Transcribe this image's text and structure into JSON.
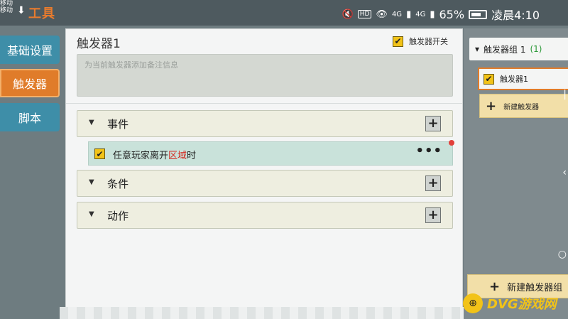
{
  "statusbar": {
    "notif_line1": "移动",
    "notif_line2": "移动",
    "app_title": "工具",
    "hd": "HD",
    "signal1": "4G",
    "signal2": "4G",
    "battery": "65%",
    "time": "凌晨4:10"
  },
  "sidebar": {
    "items": [
      {
        "label": "基础设置"
      },
      {
        "label": "触发器"
      },
      {
        "label": "脚本"
      }
    ]
  },
  "main": {
    "title": "触发器1",
    "switch_label": "触发器开关",
    "note_placeholder": "为当前触发器添加备注信息",
    "sections": {
      "event": "事件",
      "condition": "条件",
      "action": "动作"
    },
    "event_row": {
      "text_before": "任意玩家离开",
      "text_highlight": "区域",
      "text_after": "时",
      "more": "•••"
    }
  },
  "right": {
    "group_label": "触发器组 1",
    "group_count": "(1)",
    "trigger_item": "触发器1",
    "new_trigger": "新建触发器",
    "new_group": "新建触发器组"
  },
  "watermark": {
    "text": "DVG游戏网"
  }
}
